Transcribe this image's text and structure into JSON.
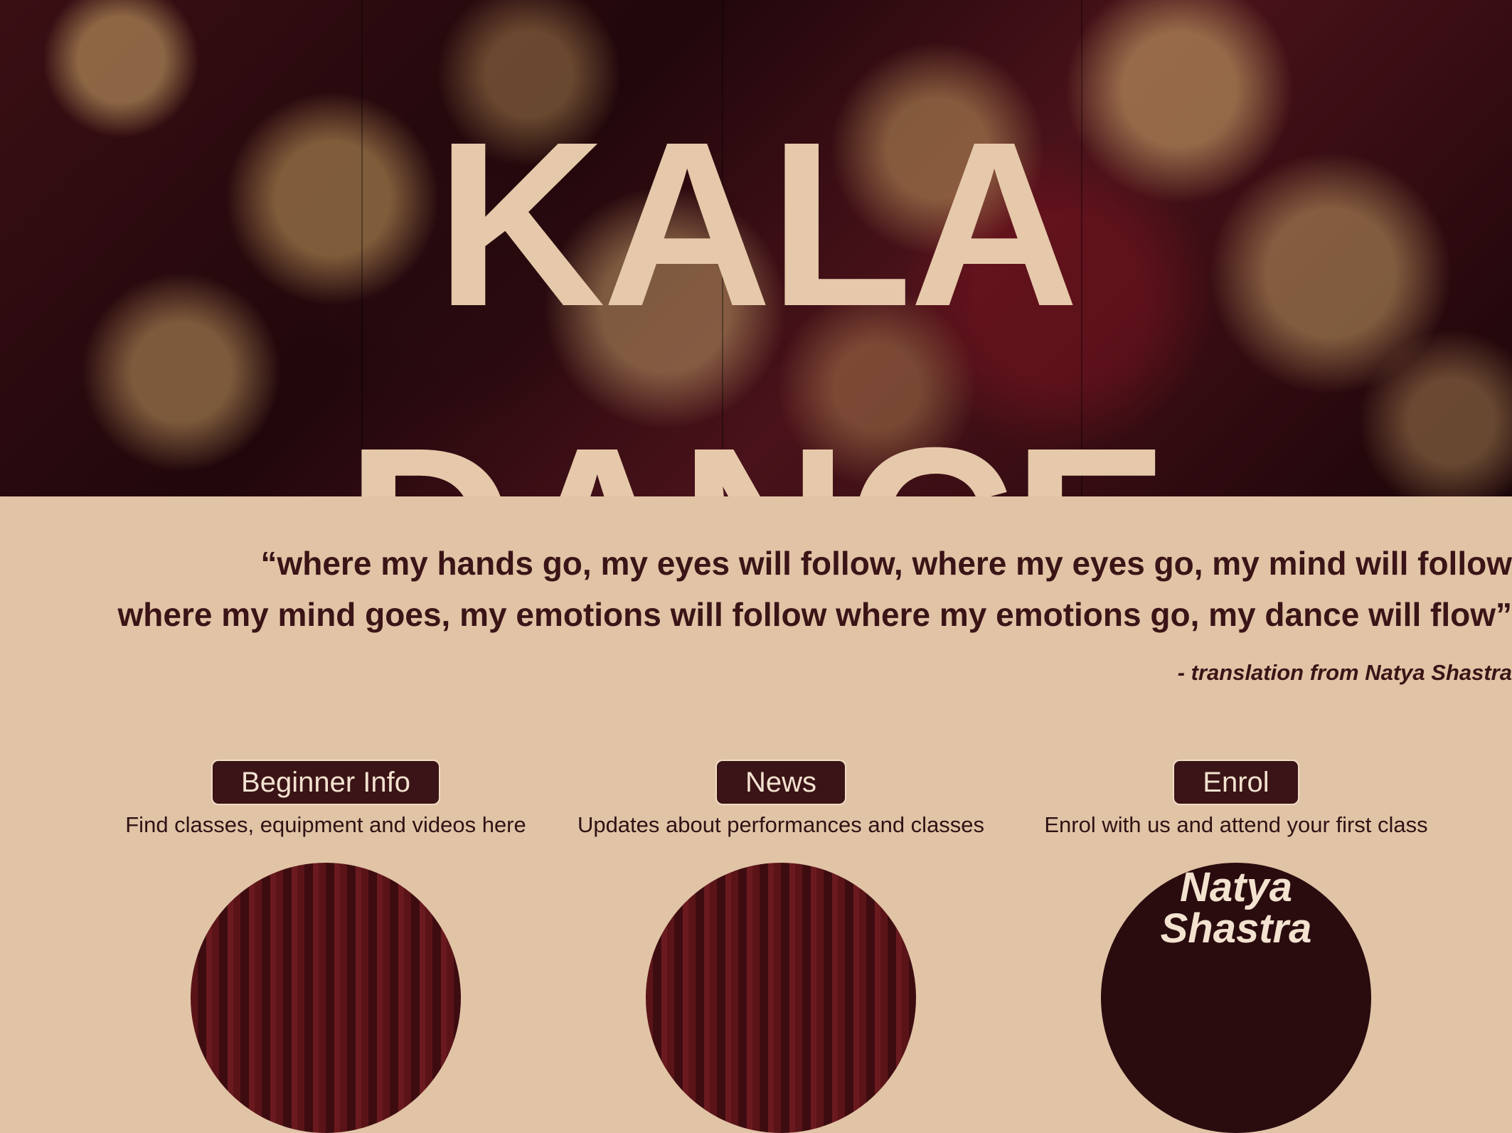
{
  "hero": {
    "title_line1": "KALA",
    "title_line2": "DANCE"
  },
  "quote": {
    "line1": "“where my hands go, my eyes will follow, where my eyes go, my mind will follow",
    "line2": "where my mind goes, my emotions will follow where my emotions go, my dance will flow”",
    "attribution": "- translation from Natya Shastra"
  },
  "cards": [
    {
      "button": "Beginner Info",
      "description": "Find classes, equipment and videos here"
    },
    {
      "button": "News",
      "description": "Updates about performances and classes"
    },
    {
      "button": "Enrol",
      "description": "Enrol with us and attend your first class"
    }
  ],
  "thumbs": {
    "third_text": "Natya Shastra"
  }
}
